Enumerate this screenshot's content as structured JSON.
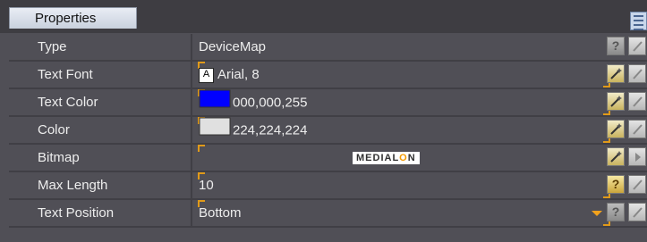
{
  "panel": {
    "tab_label": "Properties"
  },
  "properties": [
    {
      "name": "Type",
      "value": "DeviceMap",
      "button": "help-icon"
    },
    {
      "name": "Text Font",
      "value": "Arial, 8",
      "button": "wand-icon"
    },
    {
      "name": "Text Color",
      "value": "000,000,255",
      "swatch": "#0000ff",
      "button": "wand-icon"
    },
    {
      "name": "Color",
      "value": "224,224,224",
      "swatch": "#e0e0e0",
      "button": "wand-icon"
    },
    {
      "name": "Bitmap",
      "value": "MEDIALON",
      "button": "wand-icon"
    },
    {
      "name": "Max Length",
      "value": "10",
      "button": "help-icon"
    },
    {
      "name": "Text Position",
      "value": "Bottom",
      "button": "help-icon",
      "dropdown": true
    }
  ],
  "colors": {
    "background": "#504f56",
    "separator": "#403f45",
    "accent": "#e09a1a",
    "text": "#ededed"
  }
}
